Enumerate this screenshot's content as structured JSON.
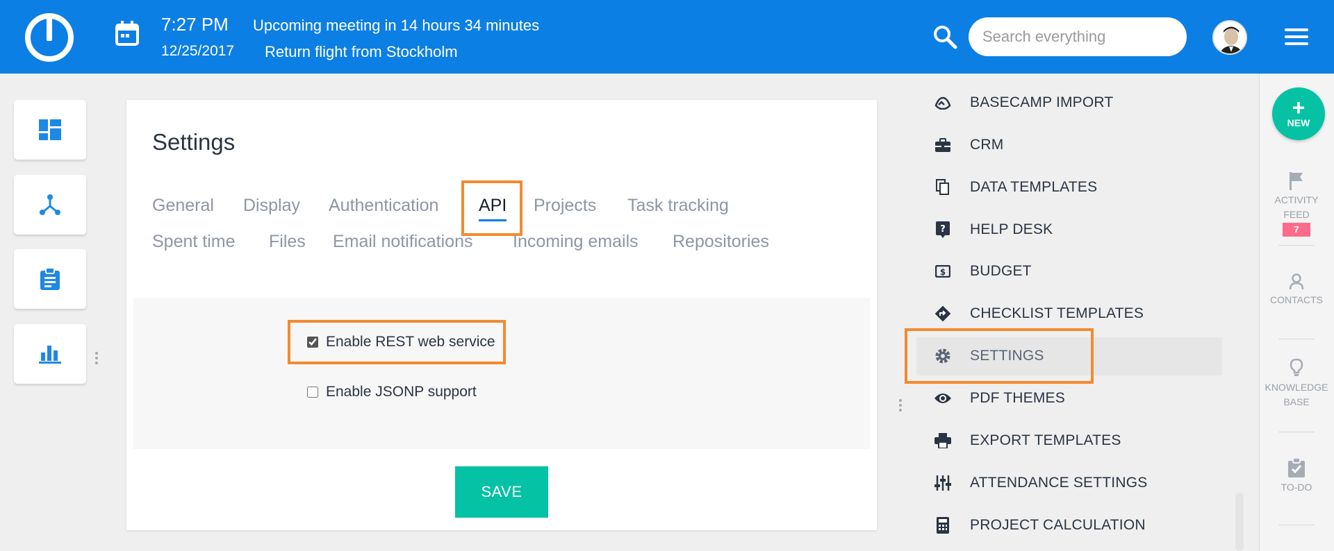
{
  "header": {
    "time": "7:27 PM",
    "date": "12/25/2017",
    "event_1": "Upcoming meeting in 14 hours 34 minutes",
    "event_2": "Return flight from Stockholm",
    "search_placeholder": "Search everything"
  },
  "settings": {
    "title": "Settings",
    "tabs": [
      {
        "label": "General"
      },
      {
        "label": "Display"
      },
      {
        "label": "Authentication"
      },
      {
        "label": "API",
        "active": true
      },
      {
        "label": "Projects"
      },
      {
        "label": "Task tracking"
      },
      {
        "label": "Spent time"
      },
      {
        "label": "Files"
      },
      {
        "label": "Email notifications"
      },
      {
        "label": "Incoming emails"
      },
      {
        "label": "Repositories"
      }
    ],
    "options": [
      {
        "label": "Enable REST web service",
        "checked": true
      },
      {
        "label": "Enable JSONP support",
        "checked": false
      }
    ],
    "save_label": "SAVE"
  },
  "admin_menu": {
    "items": [
      {
        "label": "BASECAMP IMPORT",
        "icon": "basecamp-icon"
      },
      {
        "label": "CRM",
        "icon": "briefcase-icon"
      },
      {
        "label": "DATA TEMPLATES",
        "icon": "copy-icon"
      },
      {
        "label": "HELP DESK",
        "icon": "question-icon"
      },
      {
        "label": "BUDGET",
        "icon": "money-icon"
      },
      {
        "label": "CHECKLIST TEMPLATES",
        "icon": "directions-icon"
      },
      {
        "label": "SETTINGS",
        "icon": "gear-icon",
        "active": true
      },
      {
        "label": "PDF THEMES",
        "icon": "eye-icon"
      },
      {
        "label": "EXPORT TEMPLATES",
        "icon": "printer-icon"
      },
      {
        "label": "ATTENDANCE SETTINGS",
        "icon": "sliders-icon"
      },
      {
        "label": "PROJECT CALCULATION",
        "icon": "calculator-icon"
      }
    ]
  },
  "right_sidebar": {
    "new_label": "NEW",
    "activity_label": "ACTIVITY FEED",
    "activity_line1": "ACTIVITY",
    "activity_line2": "FEED",
    "activity_count": "7",
    "contacts_label": "CONTACTS",
    "kb_line1": "KNOWLEDGE",
    "kb_line2": "BASE",
    "todo_label": "TO-DO"
  },
  "colors": {
    "brand_blue": "#0c7fe5",
    "accent_green": "#04c2a3",
    "highlight_orange": "#f28a30",
    "badge_pink": "#ff6b8b"
  }
}
